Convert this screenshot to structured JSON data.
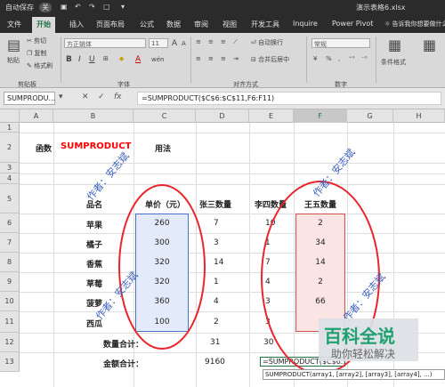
{
  "titlebar": {
    "autosave_label": "自动保存",
    "autosave_state": "关",
    "filename": "演示表格6.xlsx"
  },
  "tabs": [
    "文件",
    "开始",
    "插入",
    "页面布局",
    "公式",
    "数据",
    "审阅",
    "视图",
    "开发工具",
    "Inquire",
    "Power Pivot"
  ],
  "tell_me": "告诉我你想要做什么",
  "ribbon": {
    "clipboard": {
      "paste": "粘贴",
      "cut": "剪切",
      "copy": "复制",
      "format_painter": "格式刷",
      "group": "剪贴板"
    },
    "font": {
      "name": "方正姚体",
      "size": "11",
      "bold": "B",
      "italic": "I",
      "underline": "U",
      "grow": "A",
      "shrink": "A",
      "fontcolor": "A",
      "wen": "wén",
      "group": "字体"
    },
    "alignment": {
      "wrap": "自动换行",
      "merge": "合并后居中",
      "group": "对齐方式"
    },
    "number": {
      "format": "常规",
      "percent": "%",
      "comma": ",",
      "group": "数字"
    },
    "styles": {
      "conditional": "条件格式"
    }
  },
  "formula_bar": {
    "name_box": "SUMPRODU...",
    "cancel": "✕",
    "enter": "✓",
    "fx": "fx",
    "formula": "=SUMPRODUCT($C$6:$C$11,F6:F11)"
  },
  "columns": [
    "A",
    "B",
    "C",
    "D",
    "E",
    "F",
    "G",
    "H"
  ],
  "rows": [
    "1",
    "2",
    "3",
    "4",
    "5",
    "6",
    "7",
    "8",
    "9",
    "10",
    "11",
    "12",
    "13"
  ],
  "cells": {
    "title_label": "函数",
    "title_func": "SUMPRODUCT",
    "title_usage": "用法",
    "hdr_item": "品名",
    "hdr_price": "单价（元）",
    "hdr_z3": "张三数量",
    "hdr_l4": "李四数量",
    "hdr_w5": "王五数量",
    "items": [
      {
        "name": "苹果",
        "price": "260",
        "z3": "7",
        "l4": "10",
        "w5": "2"
      },
      {
        "name": "橘子",
        "price": "300",
        "z3": "3",
        "l4": "1",
        "w5": "34"
      },
      {
        "name": "香蕉",
        "price": "320",
        "z3": "14",
        "l4": "7",
        "w5": "14"
      },
      {
        "name": "草莓",
        "price": "320",
        "z3": "1",
        "l4": "4",
        "w5": "2"
      },
      {
        "name": "菠萝",
        "price": "360",
        "z3": "4",
        "l4": "3",
        "w5": "66"
      },
      {
        "name": "西瓜",
        "price": "100",
        "z3": "2",
        "l4": "3",
        "w5": ""
      }
    ],
    "qty_total_label": "数量合计：",
    "qty_z3": "31",
    "qty_l4": "30",
    "amt_total_label": "金额合计：",
    "amt_z3": "9160",
    "formula_edit": "=SUMPRODUCT($C$6:$C$11,F6:F11)"
  },
  "tooltip": "SUMPRODUCT(array1, [array2], [array3], [array4], ...)",
  "watermark": "作者：安志斌",
  "brand": {
    "name": "百科全说",
    "slogan": "助你轻松解决"
  },
  "colors": {
    "excel_green": "#217346",
    "title_red": "#ff0000",
    "circle_red": "#e8262d",
    "blue_fill": "#e3ebfa",
    "pink_fill": "#fbe4e4"
  }
}
